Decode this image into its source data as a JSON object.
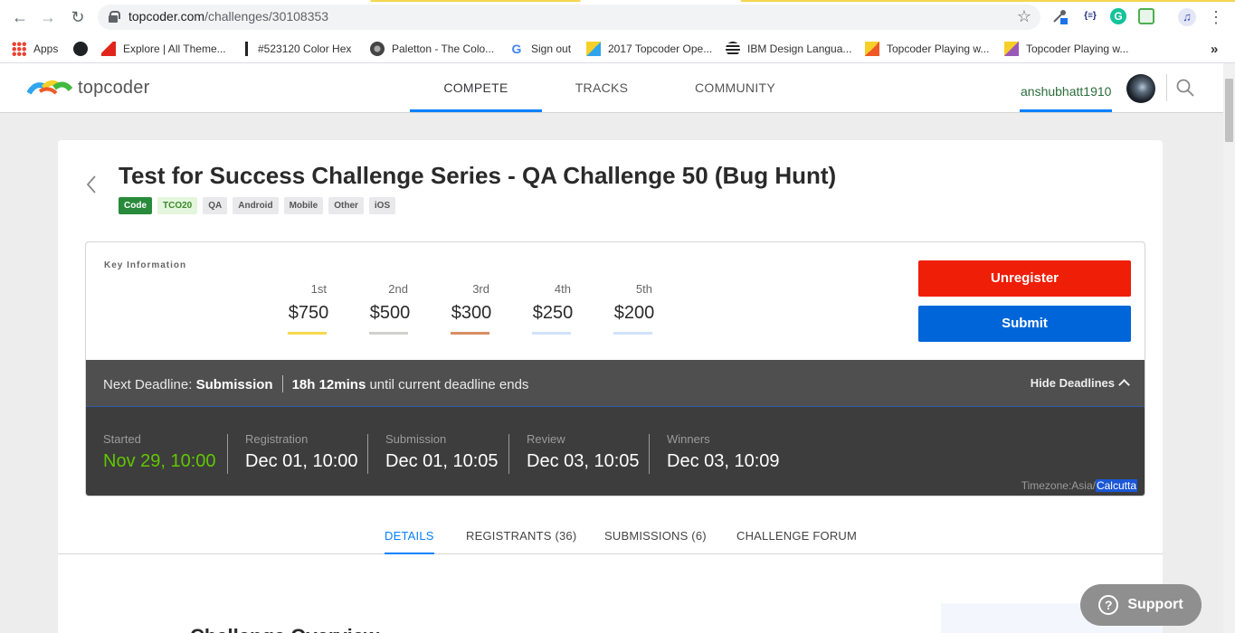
{
  "browser": {
    "url_host": "topcoder.com",
    "url_path": "/challenges/30108353",
    "bookmarks": [
      {
        "label": "Apps"
      },
      {
        "label": ""
      },
      {
        "label": "Explore | All Theme..."
      },
      {
        "label": "#523120 Color Hex"
      },
      {
        "label": "Paletton - The Colo..."
      },
      {
        "label": "Sign out"
      },
      {
        "label": "2017 Topcoder Ope..."
      },
      {
        "label": "IBM Design Langua..."
      },
      {
        "label": "Topcoder Playing w..."
      },
      {
        "label": "Topcoder Playing w..."
      }
    ],
    "more_bookmarks": "»",
    "ext_json_label": "{≡}"
  },
  "header": {
    "logo_text": "topcoder",
    "nav": [
      "COMPETE",
      "TRACKS",
      "COMMUNITY"
    ],
    "username": "anshubhatt1910"
  },
  "challenge": {
    "title": "Test for Success Challenge Series - QA Challenge 50 (Bug Hunt)",
    "tags": [
      "Code",
      "TCO20",
      "QA",
      "Android",
      "Mobile",
      "Other",
      "iOS"
    ],
    "key_info_label": "Key Information",
    "prizes": [
      {
        "place": "1st",
        "amount": "$750",
        "color": "#f9d84f"
      },
      {
        "place": "2nd",
        "amount": "$500",
        "color": "#d1d0cf"
      },
      {
        "place": "3rd",
        "amount": "$300",
        "color": "#d98f64"
      },
      {
        "place": "4th",
        "amount": "$250",
        "color": "#cfe2fb"
      },
      {
        "place": "5th",
        "amount": "$200",
        "color": "#cfe2fb"
      }
    ],
    "unregister_label": "Unregister",
    "submit_label": "Submit",
    "deadline": {
      "prefix": "Next Deadline:",
      "phase": "Submission",
      "remaining": "18h 12mins",
      "suffix": "until current deadline ends",
      "toggle": "Hide Deadlines"
    },
    "phases": [
      {
        "label": "Started",
        "date": "Nov 29, 10:00"
      },
      {
        "label": "Registration",
        "date": "Dec 01, 10:00"
      },
      {
        "label": "Submission",
        "date": "Dec 01, 10:05"
      },
      {
        "label": "Review",
        "date": "Dec 03, 10:05"
      },
      {
        "label": "Winners",
        "date": "Dec 03, 10:09"
      }
    ],
    "timezone_prefix": "Timezone:Asia/",
    "timezone_city": "Calcutta",
    "tabs": [
      "DETAILS",
      "REGISTRANTS (36)",
      "SUBMISSIONS (6)",
      "CHALLENGE FORUM"
    ],
    "overview_peek": "Challenge Overview"
  },
  "support_label": "Support",
  "colors": {
    "accent": "#0681ff",
    "unregister": "#ef1e07",
    "submit": "#0065d9",
    "started": "#60c700"
  }
}
